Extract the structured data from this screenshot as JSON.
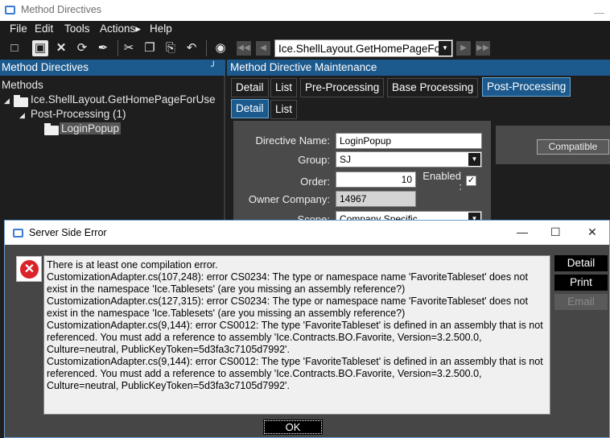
{
  "window": {
    "title": "Method Directives"
  },
  "menu": [
    "File",
    "Edit",
    "Tools",
    "Actions▸",
    "Help"
  ],
  "toolbar": {
    "combo_value": "Ice.ShellLayout.GetHomePageForUs"
  },
  "left_panel": {
    "title": "Method Directives",
    "tree": {
      "root": "Methods",
      "method": "Ice.ShellLayout.GetHomePageForUse",
      "group": "Post-Processing (1)",
      "leaf": "LoginPopup"
    }
  },
  "right_panel": {
    "title": "Method Directive Maintenance",
    "tabs": [
      "Detail",
      "List",
      "Pre-Processing",
      "Base Processing",
      "Post-Processing"
    ],
    "subtabs": [
      "Detail",
      "List"
    ],
    "form": {
      "directive_name_label": "Directive Name:",
      "directive_name": "LoginPopup",
      "group_label": "Group:",
      "group": "SJ",
      "order_label": "Order:",
      "order": "10",
      "enabled_label": "Enabled",
      "enabled_colon": ":",
      "owner_company_label": "Owner Company:",
      "owner_company": "14967",
      "scope_label": "Scope:",
      "scope": "Company Specific"
    },
    "compatible_button": "Compatible"
  },
  "dialog": {
    "title": "Server Side Error",
    "lines": [
      "There is at least one compilation error.",
      "CustomizationAdapter.cs(107,248): error CS0234: The type or namespace name 'FavoriteTableset' does not exist in the namespace 'Ice.Tablesets' (are you missing an assembly reference?)",
      "CustomizationAdapter.cs(127,315): error CS0234: The type or namespace name 'FavoriteTableset' does not exist in the namespace 'Ice.Tablesets' (are you missing an assembly reference?)",
      "CustomizationAdapter.cs(9,144): error CS0012: The type 'FavoriteTableset' is defined in an assembly that is not referenced. You must add a reference to assembly 'Ice.Contracts.BO.Favorite, Version=3.2.500.0, Culture=neutral, PublicKeyToken=5d3fa3c7105d7992'.",
      "CustomizationAdapter.cs(9,144): error CS0012: The type 'FavoriteTableset' is defined in an assembly that is not referenced. You must add a reference to assembly 'Ice.Contracts.BO.Favorite, Version=3.2.500.0, Culture=neutral, PublicKeyToken=5d3fa3c7105d7992'."
    ],
    "buttons": {
      "detail": "Detail",
      "print": "Print",
      "email": "Email",
      "ok": "OK"
    }
  },
  "icons": [
    "new-icon",
    "save-icon",
    "delete-icon",
    "refresh-icon",
    "clear-icon",
    "cut-icon",
    "copy-icon",
    "paste-icon",
    "undo-icon",
    "binoculars-icon",
    "first-icon",
    "prev-icon",
    "next-icon",
    "last-icon",
    "pin-icon",
    "error-icon"
  ],
  "colors": {
    "accent": "#1c5a8e",
    "error": "#d9242a",
    "background": "#1e1e1e"
  }
}
